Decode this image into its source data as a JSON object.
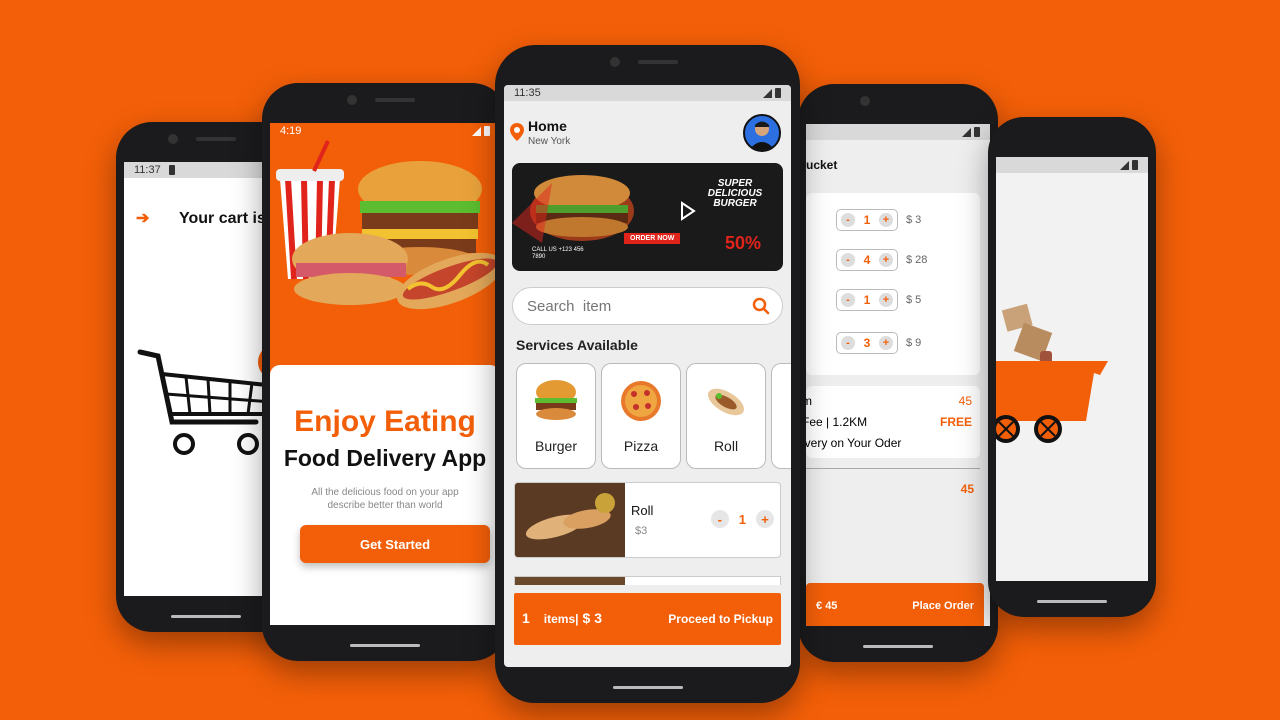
{
  "phone1": {
    "time": "11:37",
    "cart_title": "Your cart is"
  },
  "phone2": {
    "time": "4:19",
    "headline": "Enjoy Eating",
    "subheadline": "Food Delivery App",
    "description": "All the delicious food on your app describe better than world",
    "cta_label": "Get Started"
  },
  "phone3": {
    "time": "11:35",
    "location_label": "Home",
    "city": "New York",
    "banner": {
      "title": "SUPER DELICIOUS BURGER",
      "order_now": "ORDER NOW",
      "discount": "50%",
      "call": "CALL US +123 456 7890"
    },
    "search_placeholder": "Search  item",
    "services_title": "Services Available",
    "services": [
      {
        "label": "Burger"
      },
      {
        "label": "Pizza"
      },
      {
        "label": "Roll"
      }
    ],
    "cart_item": {
      "name": "Roll",
      "price": "$3",
      "qty": "1"
    },
    "summary": {
      "count": "1",
      "items_label": "items|",
      "total": "$ 3",
      "action": "Proceed to Pickup"
    }
  },
  "phone4": {
    "title": "ucket",
    "rows": [
      {
        "qty": "1",
        "price": "$ 3"
      },
      {
        "qty": "4",
        "price": "$ 28"
      },
      {
        "qty": "1",
        "price": "$ 5"
      },
      {
        "qty": "3",
        "price": "$ 9"
      }
    ],
    "summary": {
      "item_label": "m",
      "item_value": "45",
      "fee_label": "Fee | 1.2KM",
      "fee_value": "FREE",
      "delivery_label": "ivery on Your Oder",
      "total_value": "45"
    },
    "place_total": "45",
    "place_label": "Place Order"
  },
  "colors": {
    "accent": "#f35f08"
  }
}
